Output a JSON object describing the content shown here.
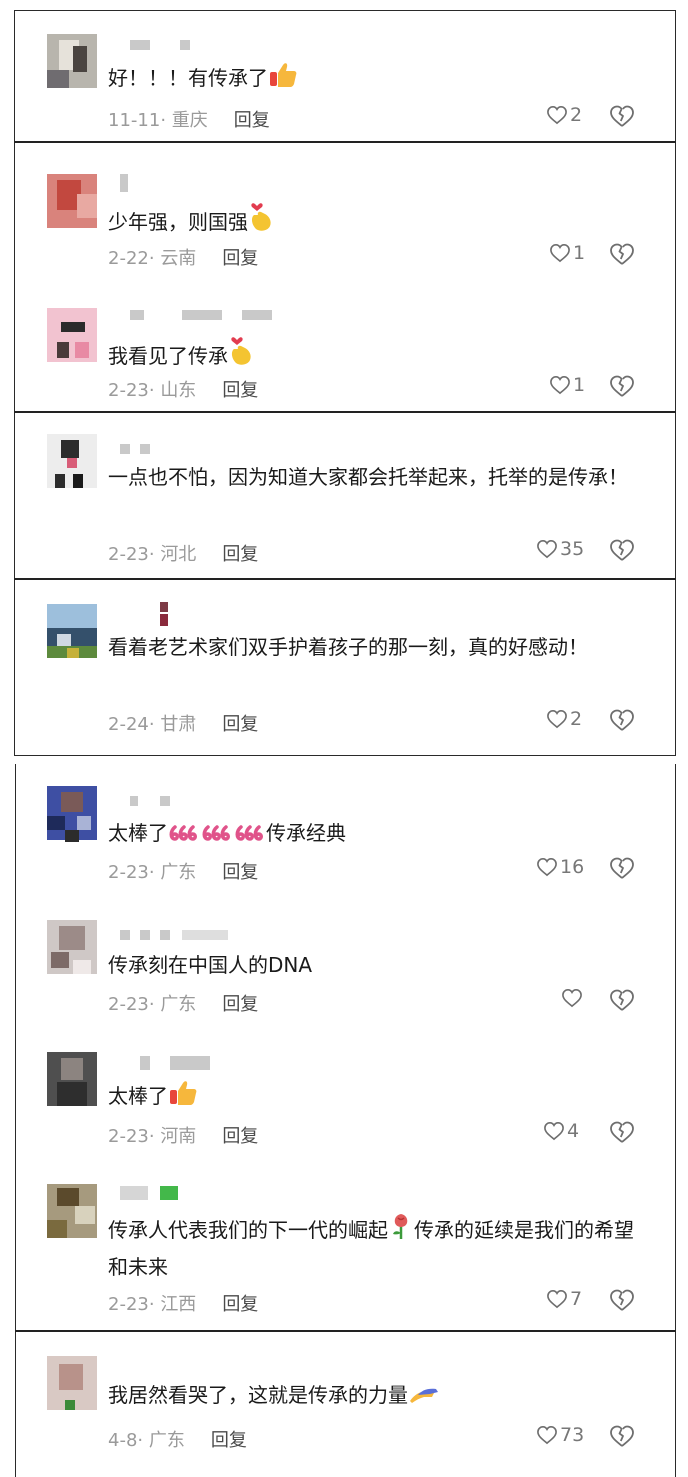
{
  "comments": [
    {
      "text": "好！！！有传承了",
      "date": "11-11",
      "location": "重庆",
      "reply": "回复",
      "likes": "2"
    },
    {
      "text": "少年强，则国强",
      "date": "2-22",
      "location": "云南",
      "reply": "回复",
      "likes": "1"
    },
    {
      "text": "我看见了传承",
      "date": "2-23",
      "location": "山东",
      "reply": "回复",
      "likes": "1"
    },
    {
      "text": "一点也不怕，因为知道大家都会托举起来，托举的是传承！",
      "date": "2-23",
      "location": "河北",
      "reply": "回复",
      "likes": "35"
    },
    {
      "text": "看着老艺术家们双手护着孩子的那一刻，真的好感动！",
      "date": "2-24",
      "location": "甘肃",
      "reply": "回复",
      "likes": "2"
    },
    {
      "text_a": "太棒了",
      "text_b": "传承经典",
      "date": "2-23",
      "location": "广东",
      "reply": "回复",
      "likes": "16"
    },
    {
      "text": "传承刻在中国人的DNA",
      "date": "2-23",
      "location": "广东",
      "reply": "回复",
      "likes": ""
    },
    {
      "text": "太棒了",
      "date": "2-23",
      "location": "河南",
      "reply": "回复",
      "likes": "4"
    },
    {
      "text_a": "传承人代表我们的下一代的崛起",
      "text_b": "传承的延续是我们的希望和未来",
      "date": "2-23",
      "location": "江西",
      "reply": "回复",
      "likes": "7"
    },
    {
      "text": "我居然看哭了，这就是传承的力量",
      "date": "4-8",
      "location": "广东",
      "reply": "回复",
      "likes": "73"
    }
  ],
  "icons": {
    "like": "heart-outline-icon",
    "dislike": "broken-heart-icon",
    "thumbs": "thumbs-up-emoji",
    "finger_heart": "finger-heart-emoji",
    "six": "six-six-six-emoji",
    "rose": "rose-emoji",
    "hands": "hands-emoji"
  }
}
